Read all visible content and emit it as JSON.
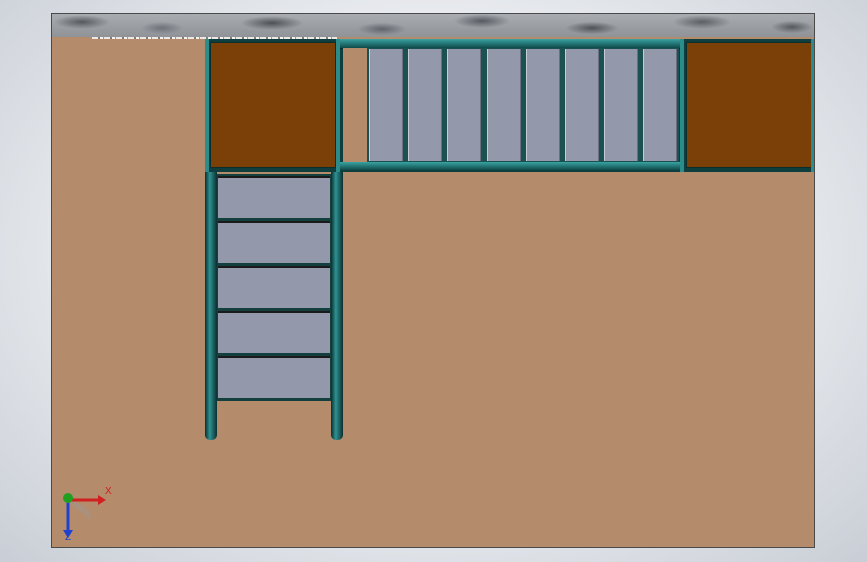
{
  "viewport": {
    "background_color": "#b48b6b",
    "frame_color": "#2c8c8c",
    "pad_color": "#7b3f08",
    "grating_color": "#9399ab"
  },
  "platform": {
    "grating_slat_count": 8
  },
  "stair": {
    "tread_count": 5
  },
  "triad": {
    "x_label": "X",
    "y_label": "Y",
    "z_label": "Z",
    "x_color": "#d02020",
    "y_color": "#20a020",
    "z_color": "#2040d0"
  }
}
